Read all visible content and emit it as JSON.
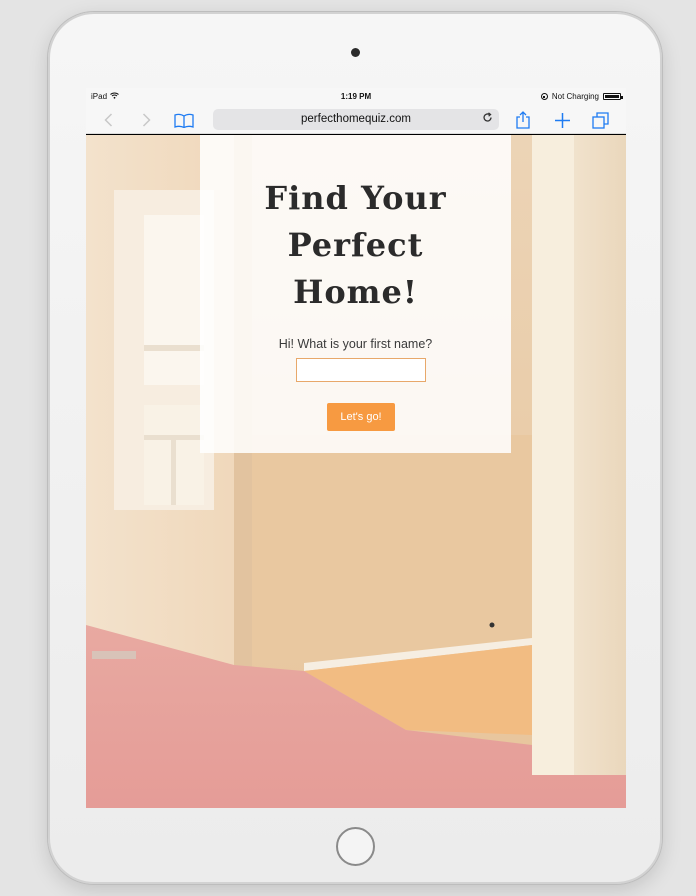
{
  "status_bar": {
    "device": "iPad",
    "time": "1:19 PM",
    "battery_status": "Not Charging"
  },
  "browser": {
    "url": "perfecthomequiz.com",
    "icons": {
      "back": "chevron-left-icon",
      "forward": "chevron-right-icon",
      "bookmarks": "book-icon",
      "reload": "reload-icon",
      "share": "share-icon",
      "new_tab": "plus-icon",
      "tabs": "tabs-icon"
    }
  },
  "page": {
    "headline_line1": "Find Your",
    "headline_line2": "Perfect",
    "headline_line3": "Home!",
    "question": "Hi! What is your first name?",
    "name_input_value": "",
    "button_label": "Let's go!"
  },
  "colors": {
    "accent": "#f79a41",
    "ios_blue": "#1e7bf2"
  }
}
